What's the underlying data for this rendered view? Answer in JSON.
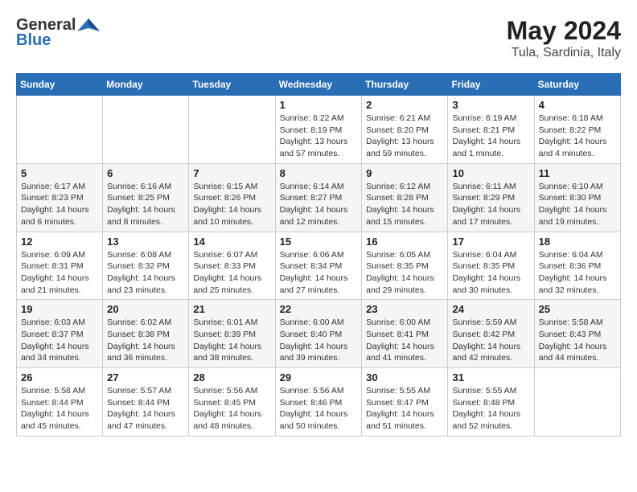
{
  "header": {
    "logo_general": "General",
    "logo_blue": "Blue",
    "month_year": "May 2024",
    "location": "Tula, Sardinia, Italy"
  },
  "days_of_week": [
    "Sunday",
    "Monday",
    "Tuesday",
    "Wednesday",
    "Thursday",
    "Friday",
    "Saturday"
  ],
  "weeks": [
    [
      {
        "day": "",
        "info": ""
      },
      {
        "day": "",
        "info": ""
      },
      {
        "day": "",
        "info": ""
      },
      {
        "day": "1",
        "info": "Sunrise: 6:22 AM\nSunset: 8:19 PM\nDaylight: 13 hours\nand 57 minutes."
      },
      {
        "day": "2",
        "info": "Sunrise: 6:21 AM\nSunset: 8:20 PM\nDaylight: 13 hours\nand 59 minutes."
      },
      {
        "day": "3",
        "info": "Sunrise: 6:19 AM\nSunset: 8:21 PM\nDaylight: 14 hours\nand 1 minute."
      },
      {
        "day": "4",
        "info": "Sunrise: 6:18 AM\nSunset: 8:22 PM\nDaylight: 14 hours\nand 4 minutes."
      }
    ],
    [
      {
        "day": "5",
        "info": "Sunrise: 6:17 AM\nSunset: 8:23 PM\nDaylight: 14 hours\nand 6 minutes."
      },
      {
        "day": "6",
        "info": "Sunrise: 6:16 AM\nSunset: 8:25 PM\nDaylight: 14 hours\nand 8 minutes."
      },
      {
        "day": "7",
        "info": "Sunrise: 6:15 AM\nSunset: 8:26 PM\nDaylight: 14 hours\nand 10 minutes."
      },
      {
        "day": "8",
        "info": "Sunrise: 6:14 AM\nSunset: 8:27 PM\nDaylight: 14 hours\nand 12 minutes."
      },
      {
        "day": "9",
        "info": "Sunrise: 6:12 AM\nSunset: 8:28 PM\nDaylight: 14 hours\nand 15 minutes."
      },
      {
        "day": "10",
        "info": "Sunrise: 6:11 AM\nSunset: 8:29 PM\nDaylight: 14 hours\nand 17 minutes."
      },
      {
        "day": "11",
        "info": "Sunrise: 6:10 AM\nSunset: 8:30 PM\nDaylight: 14 hours\nand 19 minutes."
      }
    ],
    [
      {
        "day": "12",
        "info": "Sunrise: 6:09 AM\nSunset: 8:31 PM\nDaylight: 14 hours\nand 21 minutes."
      },
      {
        "day": "13",
        "info": "Sunrise: 6:08 AM\nSunset: 8:32 PM\nDaylight: 14 hours\nand 23 minutes."
      },
      {
        "day": "14",
        "info": "Sunrise: 6:07 AM\nSunset: 8:33 PM\nDaylight: 14 hours\nand 25 minutes."
      },
      {
        "day": "15",
        "info": "Sunrise: 6:06 AM\nSunset: 8:34 PM\nDaylight: 14 hours\nand 27 minutes."
      },
      {
        "day": "16",
        "info": "Sunrise: 6:05 AM\nSunset: 8:35 PM\nDaylight: 14 hours\nand 29 minutes."
      },
      {
        "day": "17",
        "info": "Sunrise: 6:04 AM\nSunset: 8:35 PM\nDaylight: 14 hours\nand 30 minutes."
      },
      {
        "day": "18",
        "info": "Sunrise: 6:04 AM\nSunset: 8:36 PM\nDaylight: 14 hours\nand 32 minutes."
      }
    ],
    [
      {
        "day": "19",
        "info": "Sunrise: 6:03 AM\nSunset: 8:37 PM\nDaylight: 14 hours\nand 34 minutes."
      },
      {
        "day": "20",
        "info": "Sunrise: 6:02 AM\nSunset: 8:38 PM\nDaylight: 14 hours\nand 36 minutes."
      },
      {
        "day": "21",
        "info": "Sunrise: 6:01 AM\nSunset: 8:39 PM\nDaylight: 14 hours\nand 38 minutes."
      },
      {
        "day": "22",
        "info": "Sunrise: 6:00 AM\nSunset: 8:40 PM\nDaylight: 14 hours\nand 39 minutes."
      },
      {
        "day": "23",
        "info": "Sunrise: 6:00 AM\nSunset: 8:41 PM\nDaylight: 14 hours\nand 41 minutes."
      },
      {
        "day": "24",
        "info": "Sunrise: 5:59 AM\nSunset: 8:42 PM\nDaylight: 14 hours\nand 42 minutes."
      },
      {
        "day": "25",
        "info": "Sunrise: 5:58 AM\nSunset: 8:43 PM\nDaylight: 14 hours\nand 44 minutes."
      }
    ],
    [
      {
        "day": "26",
        "info": "Sunrise: 5:58 AM\nSunset: 8:44 PM\nDaylight: 14 hours\nand 45 minutes."
      },
      {
        "day": "27",
        "info": "Sunrise: 5:57 AM\nSunset: 8:44 PM\nDaylight: 14 hours\nand 47 minutes."
      },
      {
        "day": "28",
        "info": "Sunrise: 5:56 AM\nSunset: 8:45 PM\nDaylight: 14 hours\nand 48 minutes."
      },
      {
        "day": "29",
        "info": "Sunrise: 5:56 AM\nSunset: 8:46 PM\nDaylight: 14 hours\nand 50 minutes."
      },
      {
        "day": "30",
        "info": "Sunrise: 5:55 AM\nSunset: 8:47 PM\nDaylight: 14 hours\nand 51 minutes."
      },
      {
        "day": "31",
        "info": "Sunrise: 5:55 AM\nSunset: 8:48 PM\nDaylight: 14 hours\nand 52 minutes."
      },
      {
        "day": "",
        "info": ""
      }
    ]
  ]
}
